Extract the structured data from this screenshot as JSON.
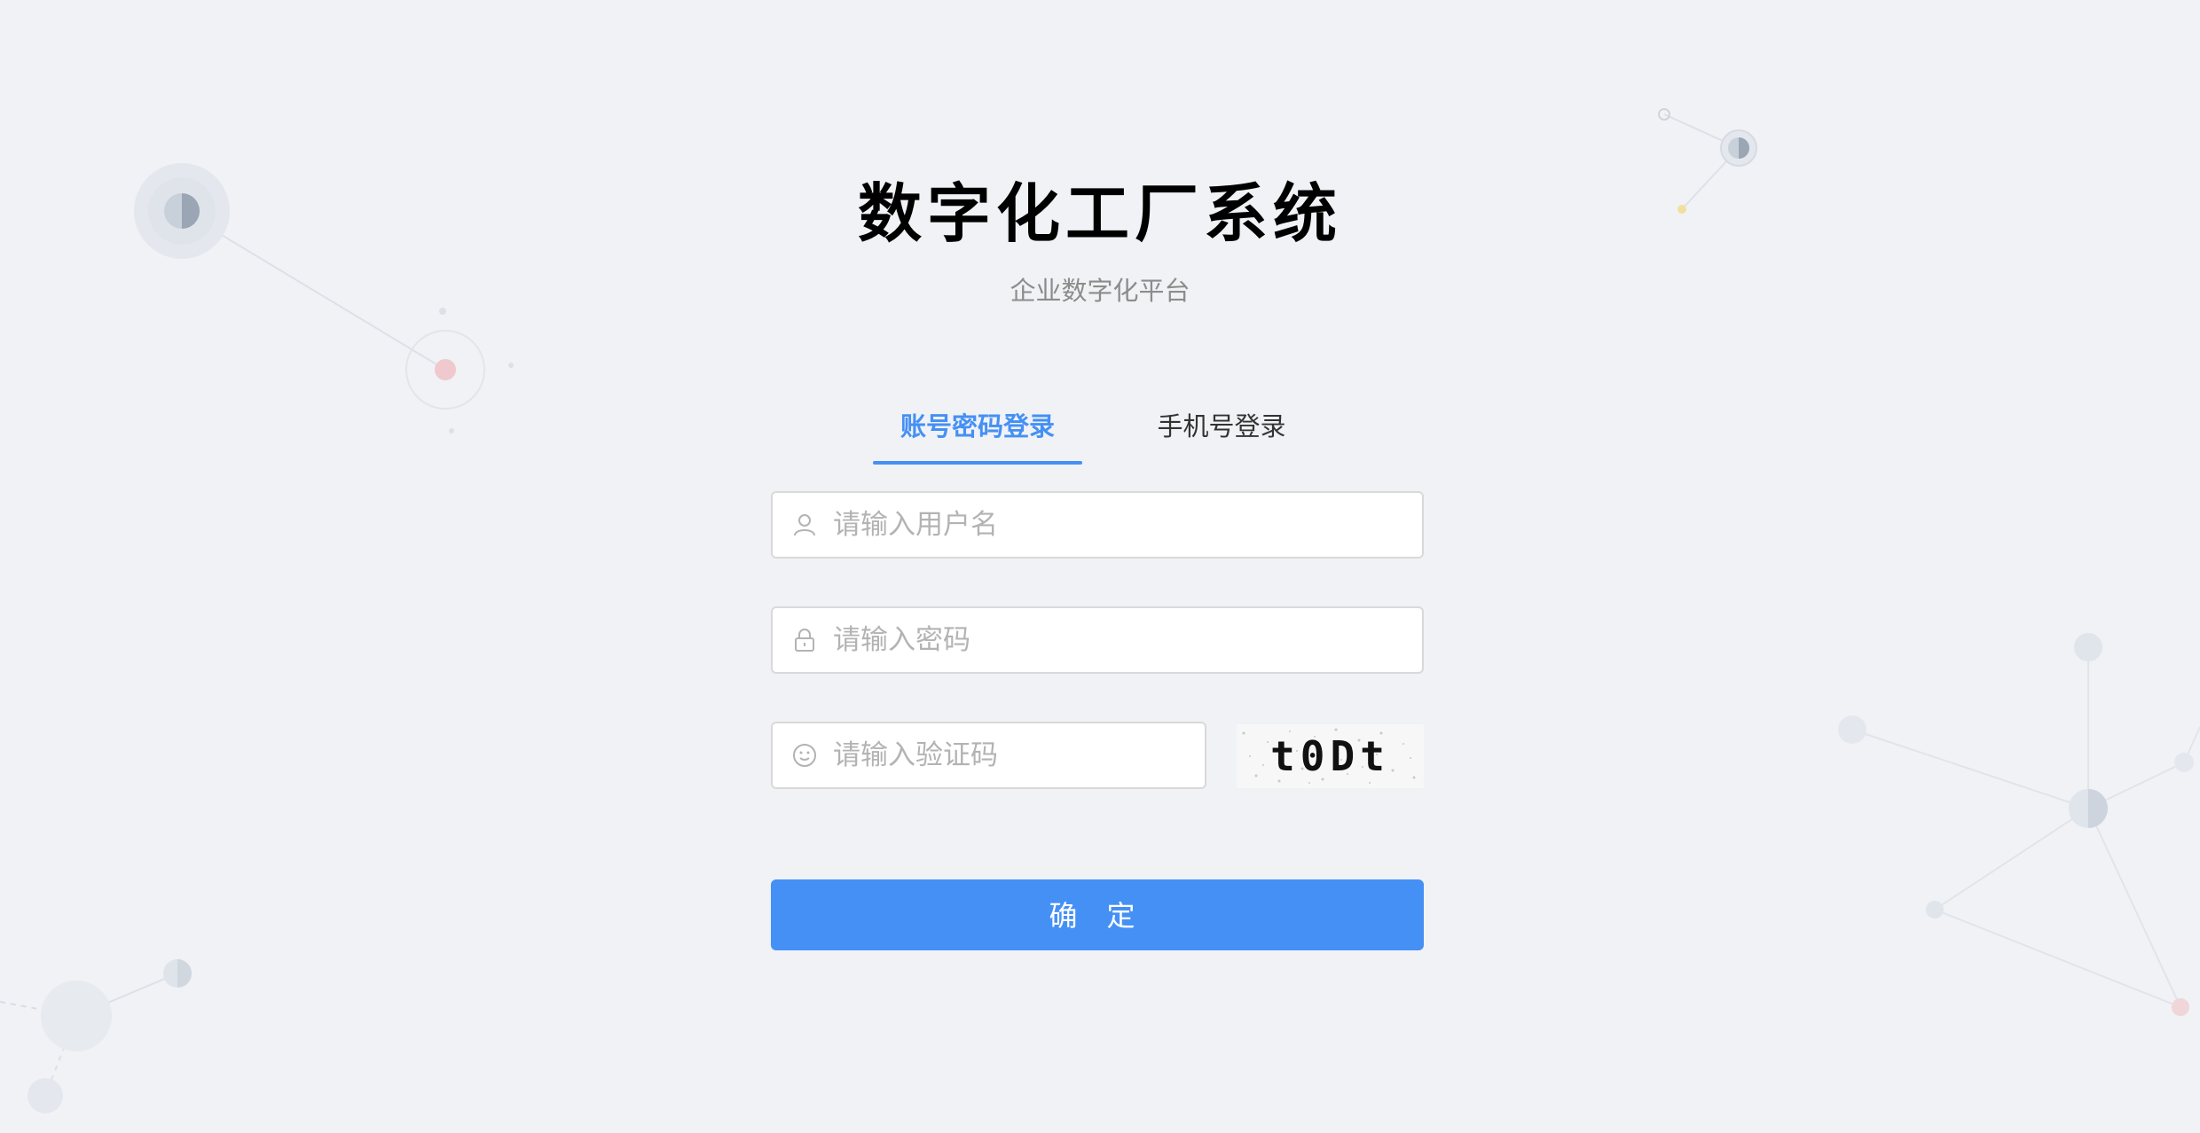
{
  "app": {
    "title": "数字化工厂系统",
    "subtitle": "企业数字化平台"
  },
  "tabs": [
    {
      "label": "账号密码登录",
      "active": true
    },
    {
      "label": "手机号登录",
      "active": false
    }
  ],
  "form": {
    "username_placeholder": "请输入用户名",
    "password_placeholder": "请输入密码",
    "captcha_placeholder": "请输入验证码",
    "captcha_text": "t0Dt",
    "submit_label": "确 定"
  },
  "icons": {
    "username": "user-icon",
    "password": "lock-icon",
    "captcha": "smile-icon"
  },
  "colors": {
    "accent": "#4590f5",
    "background": "#f0f2f5",
    "placeholder": "#b3b3b3",
    "subtitle": "#8c8c8c"
  }
}
